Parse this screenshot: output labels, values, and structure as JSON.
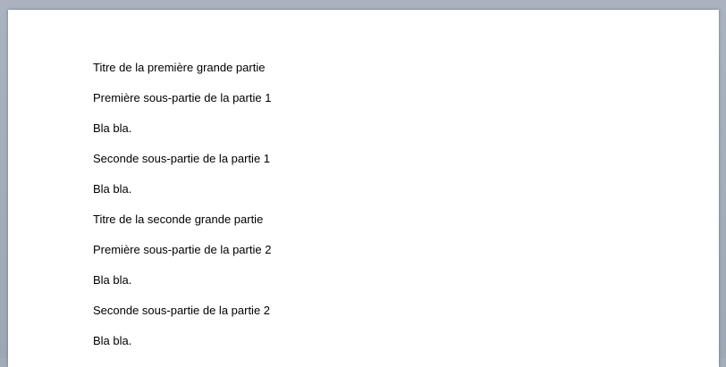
{
  "document": {
    "paragraphs": [
      "Titre de la première grande partie",
      "Première sous-partie de la partie 1",
      "Bla bla.",
      "Seconde sous-partie de la partie 1",
      "Bla bla.",
      "Titre de la seconde grande partie",
      "Première sous-partie de la partie 2",
      "Bla bla.",
      "Seconde sous-partie de la partie 2",
      "Bla bla."
    ]
  }
}
